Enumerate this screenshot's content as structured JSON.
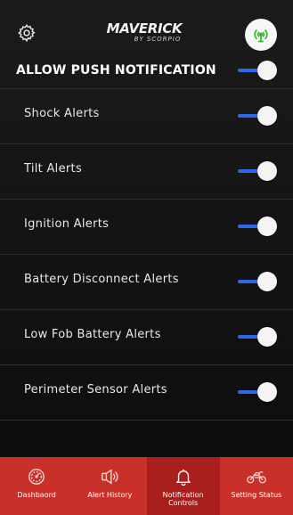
{
  "header": {
    "brand_main": "MAVERICK",
    "brand_sub": "BY SCORPIO",
    "settings_icon": "gear-icon",
    "signal_icon": "signal-tower-icon",
    "signal_color": "#2eb82e"
  },
  "master": {
    "label": "ALLOW PUSH NOTIFICATION",
    "enabled": true
  },
  "alerts": [
    {
      "label": "Shock Alerts",
      "enabled": true
    },
    {
      "label": "Tilt Alerts",
      "enabled": true
    },
    {
      "label": "Ignition Alerts",
      "enabled": true
    },
    {
      "label": "Battery Disconnect Alerts",
      "enabled": true
    },
    {
      "label": "Low Fob Battery Alerts",
      "enabled": true
    },
    {
      "label": "Perimeter Sensor Alerts",
      "enabled": true
    }
  ],
  "nav": [
    {
      "label": "Dashbaord",
      "icon": "speedometer-icon",
      "active": false
    },
    {
      "label": "Alert History",
      "icon": "speaker-icon",
      "active": false
    },
    {
      "label": "Notification\nControls",
      "icon": "bell-icon",
      "active": true
    },
    {
      "label": "Setting Status",
      "icon": "motorcycle-icon",
      "active": false
    }
  ],
  "colors": {
    "accent_blue": "#2f66ea",
    "nav_red": "#c9302a",
    "nav_active": "#a81f1d"
  }
}
